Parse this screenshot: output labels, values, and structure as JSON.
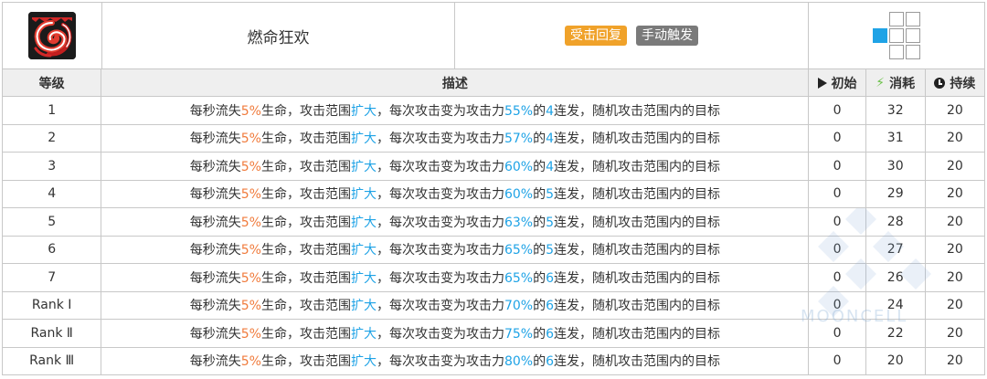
{
  "skill": {
    "icon_name": "skill-crimson-vortex-icon",
    "name": "燃命狂欢",
    "tags": [
      "受击回复",
      "手动触发"
    ]
  },
  "range": {
    "label": "range-grid"
  },
  "table": {
    "headers": {
      "level": "等级",
      "description": "描述",
      "initial": "初始",
      "cost": "消耗",
      "duration": "持续"
    },
    "rows": [
      {
        "level": "1",
        "d_pre": "每秒流失",
        "d_hp": "5%",
        "d_mid1": "生命，攻击范围",
        "d_expand": "扩大",
        "d_mid2": "，每次攻击变为攻击力",
        "d_atk": "55%",
        "d_of": "的",
        "d_hits": "4",
        "d_end": "连发，随机攻击范围内的目标",
        "initial": "0",
        "cost": "32",
        "duration": "20"
      },
      {
        "level": "2",
        "d_pre": "每秒流失",
        "d_hp": "5%",
        "d_mid1": "生命，攻击范围",
        "d_expand": "扩大",
        "d_mid2": "，每次攻击变为攻击力",
        "d_atk": "57%",
        "d_of": "的",
        "d_hits": "4",
        "d_end": "连发，随机攻击范围内的目标",
        "initial": "0",
        "cost": "31",
        "duration": "20"
      },
      {
        "level": "3",
        "d_pre": "每秒流失",
        "d_hp": "5%",
        "d_mid1": "生命，攻击范围",
        "d_expand": "扩大",
        "d_mid2": "，每次攻击变为攻击力",
        "d_atk": "60%",
        "d_of": "的",
        "d_hits": "4",
        "d_end": "连发，随机攻击范围内的目标",
        "initial": "0",
        "cost": "30",
        "duration": "20"
      },
      {
        "level": "4",
        "d_pre": "每秒流失",
        "d_hp": "5%",
        "d_mid1": "生命，攻击范围",
        "d_expand": "扩大",
        "d_mid2": "，每次攻击变为攻击力",
        "d_atk": "60%",
        "d_of": "的",
        "d_hits": "5",
        "d_end": "连发，随机攻击范围内的目标",
        "initial": "0",
        "cost": "29",
        "duration": "20"
      },
      {
        "level": "5",
        "d_pre": "每秒流失",
        "d_hp": "5%",
        "d_mid1": "生命，攻击范围",
        "d_expand": "扩大",
        "d_mid2": "，每次攻击变为攻击力",
        "d_atk": "63%",
        "d_of": "的",
        "d_hits": "5",
        "d_end": "连发，随机攻击范围内的目标",
        "initial": "0",
        "cost": "28",
        "duration": "20"
      },
      {
        "level": "6",
        "d_pre": "每秒流失",
        "d_hp": "5%",
        "d_mid1": "生命，攻击范围",
        "d_expand": "扩大",
        "d_mid2": "，每次攻击变为攻击力",
        "d_atk": "65%",
        "d_of": "的",
        "d_hits": "5",
        "d_end": "连发，随机攻击范围内的目标",
        "initial": "0",
        "cost": "27",
        "duration": "20"
      },
      {
        "level": "7",
        "d_pre": "每秒流失",
        "d_hp": "5%",
        "d_mid1": "生命，攻击范围",
        "d_expand": "扩大",
        "d_mid2": "，每次攻击变为攻击力",
        "d_atk": "65%",
        "d_of": "的",
        "d_hits": "6",
        "d_end": "连发，随机攻击范围内的目标",
        "initial": "0",
        "cost": "26",
        "duration": "20"
      },
      {
        "level": "Rank Ⅰ",
        "d_pre": "每秒流失",
        "d_hp": "5%",
        "d_mid1": "生命，攻击范围",
        "d_expand": "扩大",
        "d_mid2": "，每次攻击变为攻击力",
        "d_atk": "70%",
        "d_of": "的",
        "d_hits": "6",
        "d_end": "连发，随机攻击范围内的目标",
        "initial": "0",
        "cost": "24",
        "duration": "20"
      },
      {
        "level": "Rank Ⅱ",
        "d_pre": "每秒流失",
        "d_hp": "5%",
        "d_mid1": "生命，攻击范围",
        "d_expand": "扩大",
        "d_mid2": "，每次攻击变为攻击力",
        "d_atk": "75%",
        "d_of": "的",
        "d_hits": "6",
        "d_end": "连发，随机攻击范围内的目标",
        "initial": "0",
        "cost": "22",
        "duration": "20"
      },
      {
        "level": "Rank Ⅲ",
        "d_pre": "每秒流失",
        "d_hp": "5%",
        "d_mid1": "生命，攻击范围",
        "d_expand": "扩大",
        "d_mid2": "，每次攻击变为攻击力",
        "d_atk": "80%",
        "d_of": "的",
        "d_hits": "6",
        "d_end": "连发，随机攻击范围内的目标",
        "initial": "0",
        "cost": "20",
        "duration": "20"
      }
    ]
  },
  "watermark": {
    "text": "MOONCELL"
  },
  "colors": {
    "highlight_orange": "#f07b3c",
    "highlight_blue": "#1fa3e6",
    "tag_orange": "#f0a22a",
    "tag_grey": "#7a7a7a",
    "header_bg": "#efefef",
    "border": "#c8c8c8"
  }
}
